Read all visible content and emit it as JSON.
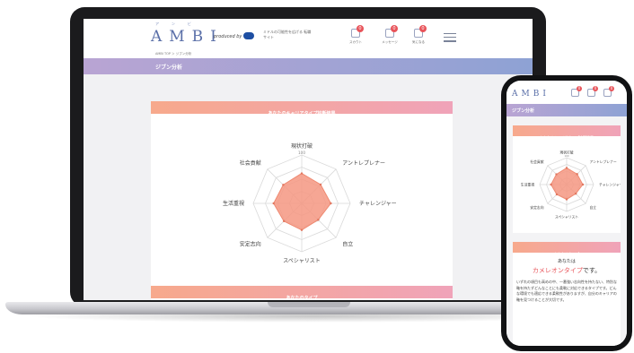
{
  "site": {
    "logo": "AMBI",
    "logo_kana": "アンビ",
    "produced_by": "produced by",
    "tagline": "ミドルの可能性を広げる 転職サイト",
    "breadcrumb": "AMBI TOP ＞ ジブン分析",
    "nav": [
      {
        "icon": "bell-icon",
        "label": "スカウト",
        "badge": "0"
      },
      {
        "icon": "mail-icon",
        "label": "メッセージ",
        "badge": "0"
      },
      {
        "icon": "bookmark-icon",
        "label": "気になる",
        "badge": "0"
      }
    ]
  },
  "page": {
    "title": "ジブン分析",
    "section_career_type": "あなたのキャリアタイプ診断結果",
    "section_your_type": "あなたのタイプ"
  },
  "radar": {
    "scale_max": "100",
    "axes": [
      "現状打破",
      "アントレプレナー",
      "チャレンジャー",
      "自立",
      "スペシャリスト",
      "安定志向",
      "生活重視",
      "社会貢献"
    ],
    "values": [
      62,
      55,
      60,
      48,
      55,
      52,
      58,
      54
    ],
    "fill_color": "#f59781",
    "grid_color": "#d9d9d9"
  },
  "phone": {
    "title": "ジブン分析",
    "section_career_type": "あなたのキャリアタイプ診断結果",
    "section_your_type": "あなたのタイプ",
    "type_prefix": "あなたは",
    "type_name": "カメレオンタイプ",
    "type_suffix": "です。",
    "description": "いずれの項目も高めの中、一番強い志向性を持たない、特別な軸を持たずどんなことにも柔軟に対応できるタイプです。どんな環境でも適応できる柔軟性がありますが、自分のキャリアの軸を見つけることが大切です。"
  },
  "colors": {
    "accent_gradient_start": "#f7a98c",
    "accent_gradient_end": "#f0a3b9",
    "title_bar_start": "#b9a4d3",
    "title_bar_end": "#8ea2d4",
    "logo": "#5a6fa8"
  }
}
